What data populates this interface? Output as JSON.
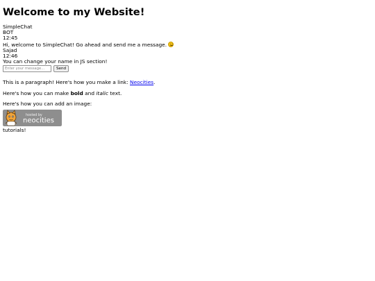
{
  "page": {
    "heading": "Welcome to my Website!"
  },
  "chat": {
    "title": "SimpleChat",
    "messages": [
      {
        "sender": "BOT",
        "time": "12:45",
        "text": "Hi, welcome to SimpleChat! Go ahead and send me a message."
      },
      {
        "sender": "Sajad",
        "time": "12:46",
        "text": "You can change your name in JS section!"
      }
    ],
    "input_placeholder": "Enter your message...",
    "send_label": "Send"
  },
  "content": {
    "paragraph1_text": "This is a paragraph! Here's how you make a link: ",
    "paragraph1_link": "Neocities",
    "paragraph1_end": ".",
    "paragraph2_start": "Here's how you can make ",
    "paragraph2_bold": "bold",
    "paragraph2_mid": " and ",
    "paragraph2_italic": "italic",
    "paragraph2_end": " text.",
    "paragraph3": "Here's how you can add an image:",
    "badge_line1": "hosted by",
    "badge_line2": "neocities",
    "footer": "tutorials!"
  },
  "colors": {
    "link": "#0000ee",
    "badge_bg": "#8e8e8e",
    "mascot": "#f0a43a"
  }
}
